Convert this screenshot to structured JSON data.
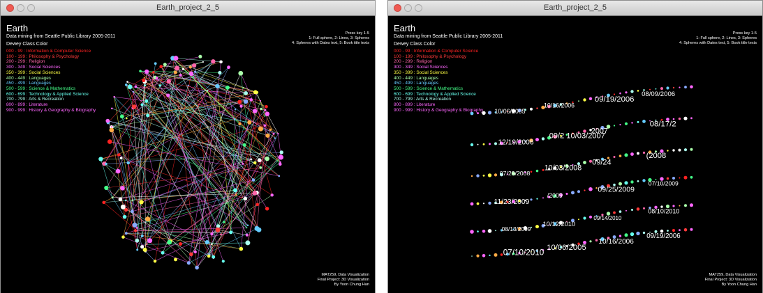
{
  "windows": [
    {
      "id": "left",
      "window_title": "Earth_project_2_5",
      "app_title": "Earth",
      "subtitle": "Data mining from Seattle Public Library 2005-2011",
      "class_heading": "Dewey Class Color",
      "help": [
        "Press key 1-5",
        "1: Full sphere, 2: Lines, 3: Spheres",
        "4: Spheres with Dates text, 5: Book title texts"
      ],
      "credits": [
        "MAT259, Data Visualization",
        "Final Project: 3D Visualization",
        "By Yoon Chung Han"
      ],
      "visualization": "lines"
    },
    {
      "id": "right",
      "window_title": "Earth_project_2_5",
      "app_title": "Earth",
      "subtitle": "Data mining from Seattle Public Library 2005-2011",
      "class_heading": "Dewey Class Color",
      "help": [
        "Press key 1-5",
        "1: Full sphere, 2: Lines, 3: Spheres",
        "4: Spheres with Dates text, 5: Book title texts"
      ],
      "credits": [
        "MAT259, Data Visualization",
        "Final Project: 3D Visualization",
        "By Yoon Chung Han"
      ],
      "visualization": "dates",
      "date_labels": [
        "10/06/2005",
        "10/16/2006",
        "09/19/2006",
        "08/09/2006",
        "12/19/2006",
        "09/2 10/03/2007",
        "2007",
        "08/17/2",
        "07/29/2008",
        "10/03/2008",
        "09/24",
        "(2008",
        "11/23/2009",
        "/2009",
        "09/25/2009",
        "07/10/2009",
        "08/13/2009",
        "10/12/2010",
        "09/14/2010",
        "08/10/2010",
        "07/10/2010"
      ]
    }
  ],
  "legend": [
    {
      "label": "000 - 99 : Information & Computer Science",
      "color": "#ff2222"
    },
    {
      "label": "100 - 199 : Philosophy & Psychology",
      "color": "#ff3a3a"
    },
    {
      "label": "200 - 299 : Religion",
      "color": "#ff66aa"
    },
    {
      "label": "300 - 349 : Social Sciences",
      "color": "#ff66ff"
    },
    {
      "label": "350 - 399 : Social Sciences",
      "color": "#ffff44"
    },
    {
      "label": "400 - 449 : Languages",
      "color": "#aaffaa"
    },
    {
      "label": "450 - 499 : Languages",
      "color": "#66ccff"
    },
    {
      "label": "500 - 599 : Science & Mathematics",
      "color": "#44ff88"
    },
    {
      "label": "600 - 699 : Technology & Applied Science",
      "color": "#66ffee"
    },
    {
      "label": "700 - 799 : Arts & Recreation",
      "color": "#aaffee"
    },
    {
      "label": "800 - 899 : Literature",
      "color": "#ff66ff"
    },
    {
      "label": "900 - 999 : History & Geography & Biography",
      "color": "#ff66ff"
    }
  ]
}
